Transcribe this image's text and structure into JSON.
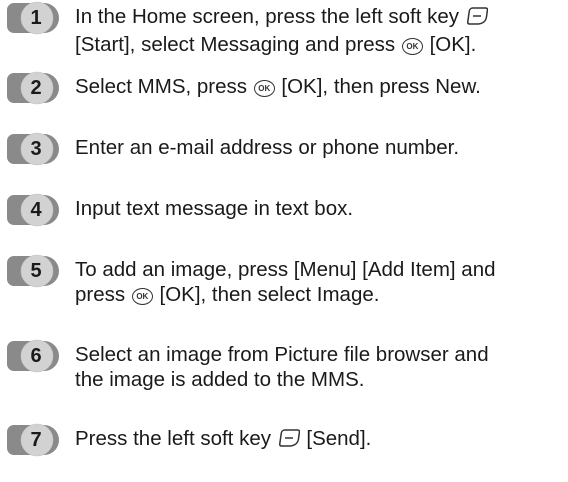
{
  "steps": [
    {
      "number": "1",
      "lines": [
        [
          "In the Home screen, press the left soft key ",
          "[[soft-key]]",
          ""
        ],
        [
          "[Start], select Messaging and press ",
          "[[ok-key]]",
          " [OK]."
        ]
      ]
    },
    {
      "number": "2",
      "lines": [
        [
          "Select MMS, press ",
          "[[ok-key]]",
          " [OK], then press New."
        ]
      ]
    },
    {
      "number": "3",
      "lines": [
        [
          "Enter an e-mail address or phone number.",
          "",
          ""
        ]
      ]
    },
    {
      "number": "4",
      "lines": [
        [
          "Input text message in text box.",
          "",
          ""
        ]
      ]
    },
    {
      "number": "5",
      "lines": [
        [
          "To add an image, press [Menu] [Add Item] and",
          "",
          ""
        ],
        [
          "press ",
          "[[ok-key]]",
          " [OK], then select Image."
        ]
      ]
    },
    {
      "number": "6",
      "lines": [
        [
          "Select an image from Picture file browser and",
          "",
          ""
        ],
        [
          "the image is added to the MMS.",
          "",
          ""
        ]
      ]
    },
    {
      "number": "7",
      "lines": [
        [
          "Press the left soft key ",
          "[[soft-key]]",
          " [Send]."
        ]
      ]
    }
  ],
  "icons": {
    "ok_key": "OK",
    "soft_key": "left-soft-key-icon"
  },
  "colors": {
    "badge_dark": "#8a8a8a",
    "badge_light": "#d2d2d2",
    "text": "#1a1a1a"
  }
}
